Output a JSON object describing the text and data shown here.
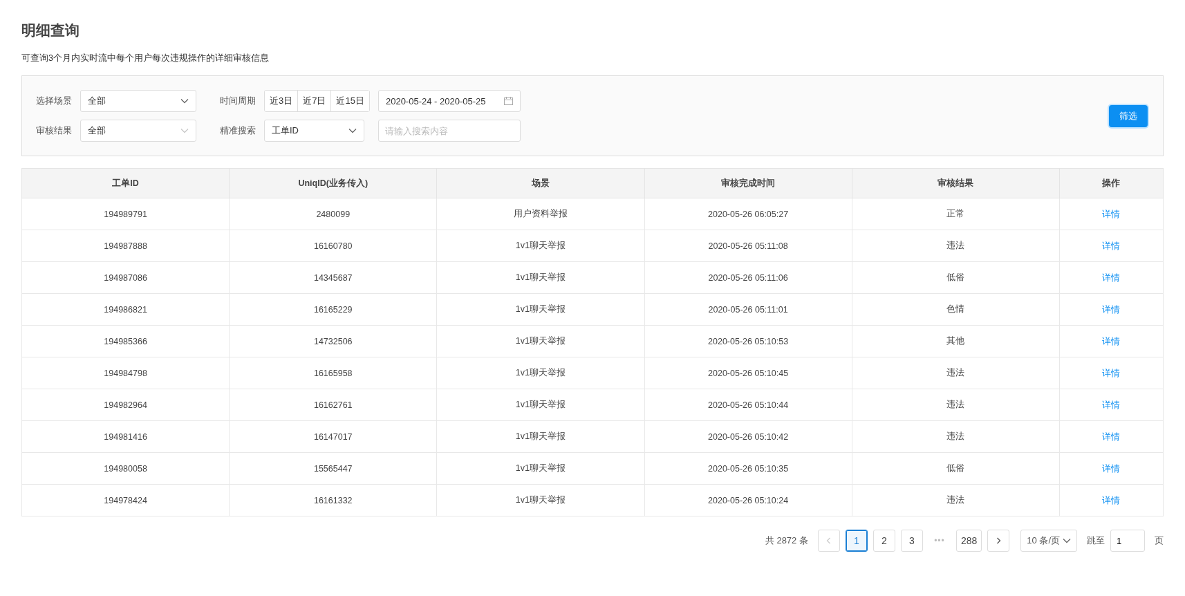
{
  "page": {
    "title": "明细查询",
    "subtitle": "可查询3个月内实时流中每个用户每次违规操作的详细审核信息"
  },
  "filters": {
    "scene": {
      "label": "选择场景",
      "value": "全部"
    },
    "result": {
      "label": "审核结果",
      "value": "全部"
    },
    "period": {
      "label": "时间周期",
      "options": [
        {
          "label": "近3日",
          "selected": false
        },
        {
          "label": "近7日",
          "selected": false
        },
        {
          "label": "近15日",
          "selected": false
        }
      ],
      "date_range": "2020-05-24 - 2020-05-25"
    },
    "search": {
      "label": "精准搜索",
      "field": "工单ID",
      "placeholder": "请输入搜索内容"
    },
    "submit": "筛选"
  },
  "table": {
    "columns": [
      "工单ID",
      "UniqID(业务传入)",
      "场景",
      "审核完成时间",
      "审核结果",
      "操作"
    ],
    "rows": [
      [
        "194989791",
        "2480099",
        "用户资料举报",
        "2020-05-26 06:05:27",
        "正常",
        "详情"
      ],
      [
        "194987888",
        "16160780",
        "1v1聊天举报",
        "2020-05-26 05:11:08",
        "违法",
        "详情"
      ],
      [
        "194987086",
        "14345687",
        "1v1聊天举报",
        "2020-05-26 05:11:06",
        "低俗",
        "详情"
      ],
      [
        "194986821",
        "16165229",
        "1v1聊天举报",
        "2020-05-26 05:11:01",
        "色情",
        "详情"
      ],
      [
        "194985366",
        "14732506",
        "1v1聊天举报",
        "2020-05-26 05:10:53",
        "其他",
        "详情"
      ],
      [
        "194984798",
        "16165958",
        "1v1聊天举报",
        "2020-05-26 05:10:45",
        "违法",
        "详情"
      ],
      [
        "194982964",
        "16162761",
        "1v1聊天举报",
        "2020-05-26 05:10:44",
        "违法",
        "详情"
      ],
      [
        "194981416",
        "16147017",
        "1v1聊天举报",
        "2020-05-26 05:10:42",
        "违法",
        "详情"
      ],
      [
        "194980058",
        "15565447",
        "1v1聊天举报",
        "2020-05-26 05:10:35",
        "低俗",
        "详情"
      ],
      [
        "194978424",
        "16161332",
        "1v1聊天举报",
        "2020-05-26 05:10:24",
        "违法",
        "详情"
      ]
    ]
  },
  "pagination": {
    "total": "共 2872 条",
    "prev_disabled": true,
    "pages": [
      {
        "label": "1",
        "selected": true
      },
      {
        "label": "2",
        "selected": false
      },
      {
        "label": "3",
        "selected": false
      },
      {
        "label": "•••",
        "kind": "ellipsis"
      },
      {
        "label": "288",
        "selected": false
      }
    ],
    "page_size": "10 条/页",
    "jump_label": "跳至",
    "jump_value": "1",
    "jump_suffix": "页"
  }
}
